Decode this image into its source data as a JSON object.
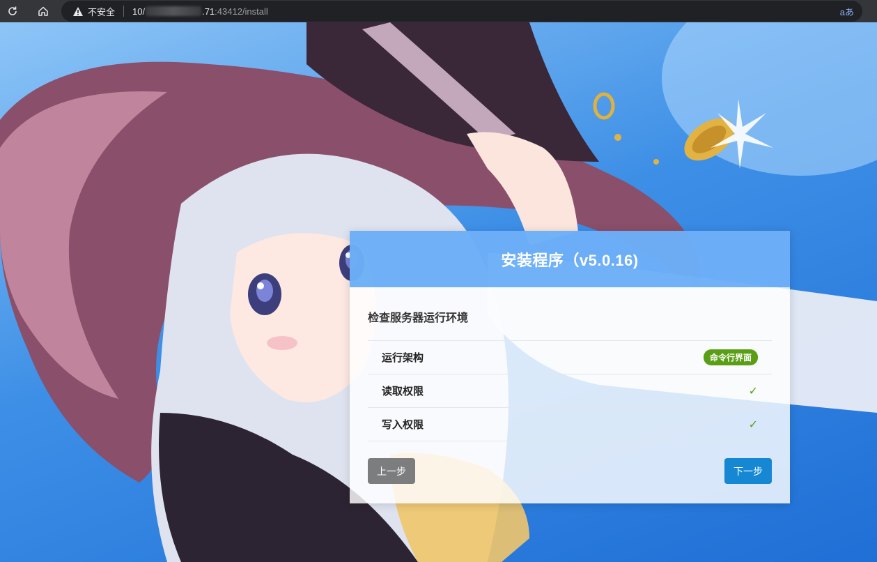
{
  "browser": {
    "security_label": "不安全",
    "url_prefix": "10/",
    "url_host_suffix": ".71",
    "url_rest": ":43412/install",
    "translate_icon": "aあ"
  },
  "installer": {
    "title": "安装程序（v5.0.16)",
    "section_title": "检查服务器运行环境",
    "checks": [
      {
        "label": "运行架构",
        "badge": "命令行界面"
      },
      {
        "label": "读取权限",
        "status": "✓"
      },
      {
        "label": "写入权限",
        "status": "✓"
      }
    ],
    "prev_button": "上一步",
    "next_button": "下一步"
  },
  "colors": {
    "header": "#52a0f5",
    "badge": "#5a9e15",
    "next_button": "#1688d3",
    "prev_button": "#7b7d7f"
  }
}
